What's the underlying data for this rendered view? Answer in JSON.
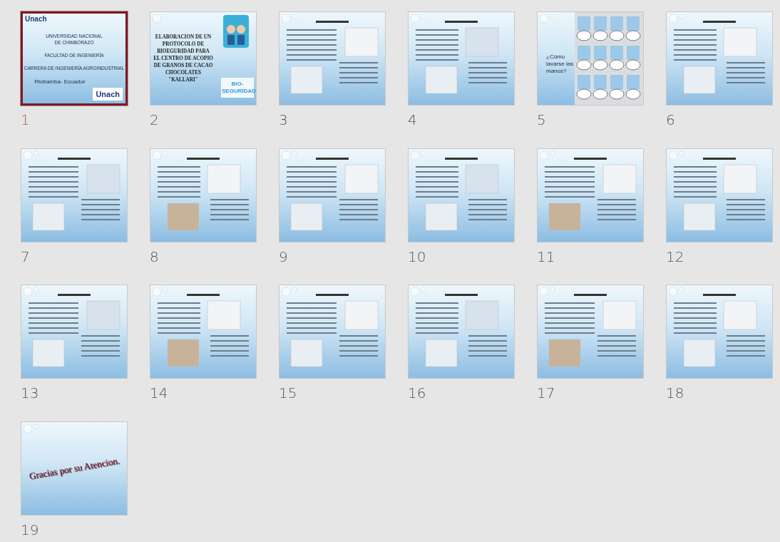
{
  "slides": [
    {
      "number": "1",
      "selected": true,
      "kind": "title",
      "logo": "Unach",
      "lines": [
        "UNIVERSIDAD NACIONAL",
        "DE CHIMBORAZO",
        "FACULTAD DE INGENIERÍA",
        "CARRERA DE INGENIERÍA AGROINDUSTRIAL"
      ],
      "place": "Riobamba- Ecuador",
      "badge": "Unach"
    },
    {
      "number": "2",
      "selected": false,
      "kind": "cover",
      "lines": [
        "ELABORACION DE UN",
        "PROTOCOLO DE",
        "BIOEGURIDAD  PARA",
        "EL CENTRO DE ACOPIO",
        "DE GRANOS DE CACAO",
        "CHOCOLATES",
        "\"KALLARI\""
      ],
      "badge": "BIO-SEGURIDAD"
    },
    {
      "number": "3",
      "selected": false,
      "kind": "content"
    },
    {
      "number": "4",
      "selected": false,
      "kind": "content"
    },
    {
      "number": "5",
      "selected": false,
      "kind": "question",
      "lines": [
        "¿Cómo lavarse las manos?"
      ]
    },
    {
      "number": "6",
      "selected": false,
      "kind": "content"
    },
    {
      "number": "7",
      "selected": false,
      "kind": "content"
    },
    {
      "number": "8",
      "selected": false,
      "kind": "content"
    },
    {
      "number": "9",
      "selected": false,
      "kind": "content"
    },
    {
      "number": "10",
      "selected": false,
      "kind": "content"
    },
    {
      "number": "11",
      "selected": false,
      "kind": "content"
    },
    {
      "number": "12",
      "selected": false,
      "kind": "content"
    },
    {
      "number": "13",
      "selected": false,
      "kind": "content"
    },
    {
      "number": "14",
      "selected": false,
      "kind": "content"
    },
    {
      "number": "15",
      "selected": false,
      "kind": "content"
    },
    {
      "number": "16",
      "selected": false,
      "kind": "content"
    },
    {
      "number": "17",
      "selected": false,
      "kind": "content"
    },
    {
      "number": "18",
      "selected": false,
      "kind": "content"
    },
    {
      "number": "19",
      "selected": false,
      "kind": "closing",
      "lines": [
        "Gracias por su Atencion."
      ]
    }
  ]
}
